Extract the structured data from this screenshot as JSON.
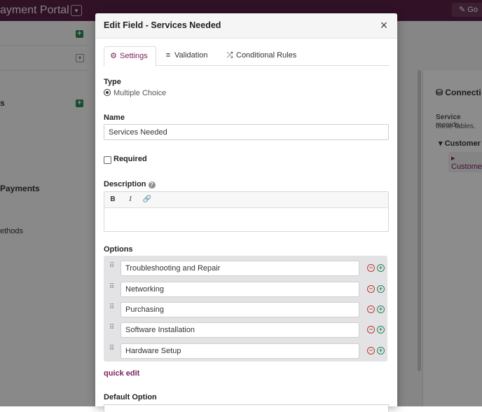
{
  "background": {
    "app_title": "ayment Portal",
    "go_button": "Go",
    "left_items": [
      "s",
      "Payments",
      "ethods"
    ],
    "right_panel": {
      "title": "Connecti",
      "text_bold": "Service",
      "text_rest": " records",
      "text_line2": "these tables.",
      "tree_item": "Customer",
      "tree_subitem": "Custome"
    }
  },
  "modal": {
    "title": "Edit Field - Services Needed",
    "tabs": [
      {
        "label": "Settings",
        "icon": "gear-icon"
      },
      {
        "label": "Validation",
        "icon": "validation-icon"
      },
      {
        "label": "Conditional Rules",
        "icon": "branch-icon"
      }
    ],
    "type": {
      "label": "Type",
      "value": "Multiple Choice"
    },
    "name": {
      "label": "Name",
      "value": "Services Needed"
    },
    "required_label": "Required",
    "description": {
      "label": "Description",
      "toolbar": {
        "bold": "B",
        "italic": "I"
      }
    },
    "options": {
      "label": "Options",
      "items": [
        "Troubleshooting and Repair",
        "Networking",
        "Purchasing",
        "Software Installation",
        "Hardware Setup"
      ]
    },
    "quick_edit": "quick edit",
    "default_option_label": "Default Option"
  },
  "colors": {
    "accent": "#7a1f5c",
    "topbar": "#5a2045",
    "remove": "#c0392b",
    "add": "#27865a"
  }
}
